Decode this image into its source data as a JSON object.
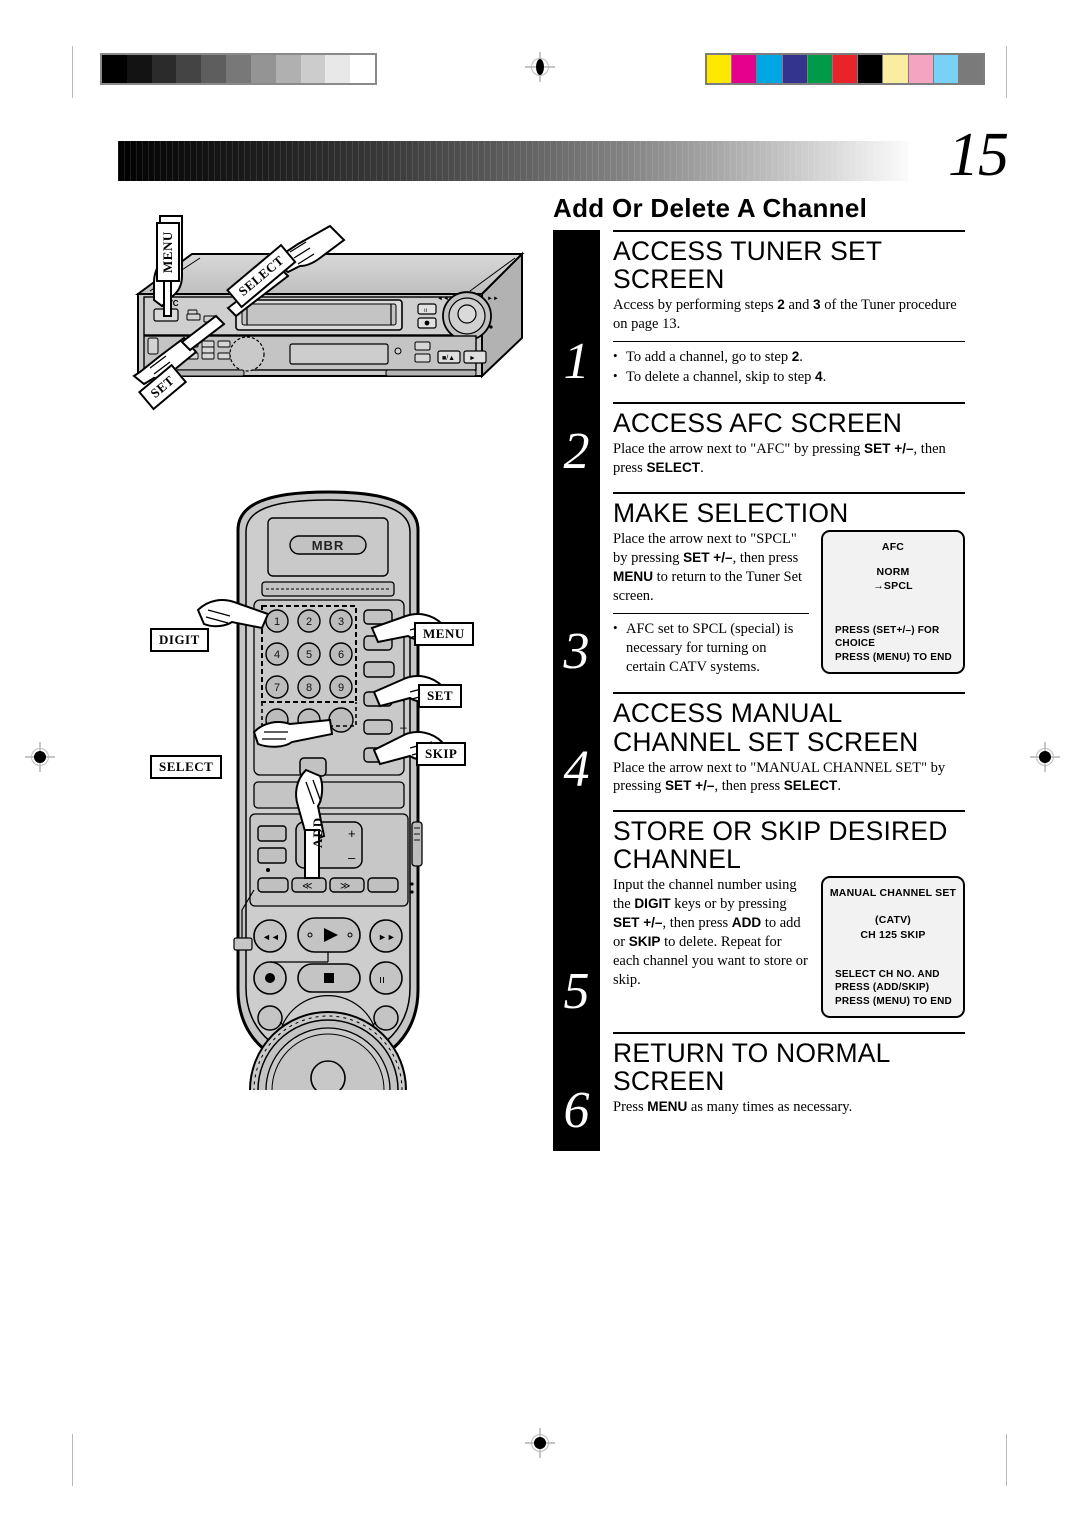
{
  "page": {
    "number": "15",
    "title": "Add Or Delete A Channel"
  },
  "calibration": {
    "grayscale_steps": [
      "#000000",
      "#131313",
      "#2b2b2b",
      "#444444",
      "#5e5e5e",
      "#787878",
      "#949494",
      "#b0b0b0",
      "#cccccc",
      "#e8e8e8",
      "#ffffff"
    ],
    "color_patches": [
      "#ffe800",
      "#e5008c",
      "#00a5e3",
      "#33348e",
      "#009a49",
      "#e8232a",
      "#000000",
      "#faeda0",
      "#f4a4c0",
      "#79d2f5",
      "#7a7a7a"
    ]
  },
  "illustrations": {
    "vcr": {
      "brand_logo": "JVC",
      "callouts": [
        {
          "id": "menu",
          "label": "MENU"
        },
        {
          "id": "select",
          "label": "SELECT"
        },
        {
          "id": "set",
          "label": "SET"
        }
      ]
    },
    "remote": {
      "badge": "MBR",
      "keypad": [
        "1",
        "2",
        "3",
        "4",
        "5",
        "6",
        "7",
        "8",
        "9"
      ],
      "callouts": [
        {
          "id": "digit",
          "label": "DIGIT"
        },
        {
          "id": "select",
          "label": "SELECT"
        },
        {
          "id": "menu",
          "label": "MENU"
        },
        {
          "id": "set",
          "label": "SET"
        },
        {
          "id": "skip",
          "label": "SKIP"
        },
        {
          "id": "add",
          "label": "ADD"
        }
      ],
      "set_plus": "+",
      "set_minus": "−",
      "rew_label": "≪",
      "ff_label": "≫"
    }
  },
  "steps": [
    {
      "number": "1",
      "heading": "ACCESS TUNER SET SCREEN",
      "body_html": "Access by performing steps <b>2</b> and <b>3</b> of the Tuner procedure on page 13.",
      "bullets_html": [
        "To add a channel, go to step <b>2</b>.",
        "To delete a channel, skip to step <b>4</b>."
      ]
    },
    {
      "number": "2",
      "heading": "ACCESS AFC SCREEN",
      "body_html": "Place the arrow next to \"AFC\" by pressing <b>SET +/–</b>, then press <b>SELECT</b>.",
      "bullets_html": []
    },
    {
      "number": "3",
      "heading": "MAKE SELECTION",
      "body_html": "Place the arrow next to \"SPCL\" by pressing <b>SET +/–</b>, then press <b>MENU</b> to return to the Tuner Set screen.",
      "bullets_html": [
        "AFC set to SPCL (special) is necessary for turning on certain CATV systems."
      ],
      "panel": {
        "title": "AFC",
        "lines": [
          "NORM",
          "→SPCL"
        ],
        "footer": [
          "PRESS (SET+/–)   FOR CHOICE",
          "PRESS (MENU) TO END"
        ]
      }
    },
    {
      "number": "4",
      "heading": "ACCESS MANUAL CHANNEL SET SCREEN",
      "body_html": "Place the arrow next to \"MANUAL CHANNEL SET\" by pressing <b>SET +/–</b>, then press <b>SELECT</b>.",
      "bullets_html": []
    },
    {
      "number": "5",
      "heading": "STORE OR SKIP DESIRED CHANNEL",
      "body_html": "Input the channel number using the <b>DIGIT</b> keys or by pressing <b>SET +/–</b>, then press <b>ADD</b> to add or <b>SKIP</b> to delete. Repeat for each channel you want to store or skip.",
      "bullets_html": [],
      "panel": {
        "title": "MANUAL CHANNEL SET",
        "lines": [
          "(CATV)",
          "CH  125  SKIP"
        ],
        "footer": [
          "SELECT CH NO. AND",
          "PRESS (ADD/SKIP)",
          "PRESS (MENU) TO END"
        ]
      }
    },
    {
      "number": "6",
      "heading": "RETURN TO NORMAL SCREEN",
      "body_html": "Press <b>MENU</b> as many times as necessary.",
      "bullets_html": []
    }
  ]
}
